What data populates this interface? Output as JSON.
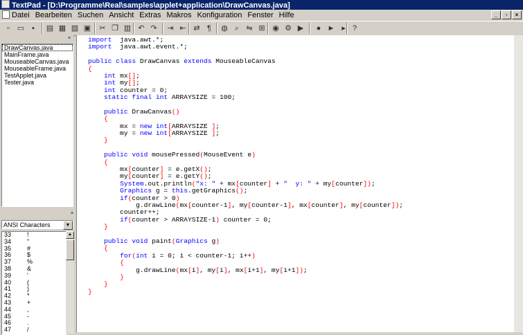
{
  "window": {
    "title": "TextPad - [D:\\Programme\\Real\\samples\\applet+application\\DrawCanvas.java]"
  },
  "menu": [
    "Datei",
    "Bearbeiten",
    "Suchen",
    "Ansicht",
    "Extras",
    "Makros",
    "Konfiguration",
    "Fenster",
    "Hilfe"
  ],
  "toolbar_icons": [
    "new-file-icon",
    "open-folder-icon",
    "save-icon",
    "save-all-icon",
    "print-icon",
    "print-preview-icon",
    "spellcheck-icon",
    "cut-icon",
    "copy-icon",
    "paste-icon",
    "undo-icon",
    "redo-icon",
    "indent-icon",
    "outdent-icon",
    "word-wrap-icon",
    "paragraph-icon",
    "web-icon",
    "find-icon",
    "find-replace-icon",
    "find-in-files-icon",
    "view-icon",
    "compile-icon",
    "run-icon",
    "record-macro-icon",
    "play-macro-icon",
    "step-macro-icon",
    "help-icon"
  ],
  "files": {
    "items": [
      "DrawCanvas.java",
      "MainFrame.java",
      "MouseableCanvas.java",
      "MouseableFrame.java",
      "TestApplet.java",
      "Tester.java"
    ],
    "selected": 0
  },
  "chars": {
    "charset": "ANSI Characters",
    "rows": [
      [
        "33",
        "!"
      ],
      [
        "34",
        "\""
      ],
      [
        "35",
        "#"
      ],
      [
        "36",
        "$"
      ],
      [
        "37",
        "%"
      ],
      [
        "38",
        "&"
      ],
      [
        "39",
        "'"
      ],
      [
        "40",
        "("
      ],
      [
        "41",
        ")"
      ],
      [
        "42",
        "*"
      ],
      [
        "43",
        "+"
      ],
      [
        "44",
        ","
      ],
      [
        "45",
        "-"
      ],
      [
        "46",
        "."
      ],
      [
        "47",
        "/"
      ]
    ]
  },
  "code": [
    [
      [
        "kw",
        "import"
      ],
      [
        "",
        "  java.awt.*;"
      ]
    ],
    [
      [
        "kw",
        "import"
      ],
      [
        "",
        "  java.awt.event.*;"
      ]
    ],
    [
      [
        "",
        ""
      ]
    ],
    [
      [
        "kw",
        "public class"
      ],
      [
        "",
        " DrawCanvas "
      ],
      [
        "kw",
        "extends"
      ],
      [
        "",
        " MouseableCanvas"
      ]
    ],
    [
      [
        "br",
        "{"
      ]
    ],
    [
      [
        "",
        "    "
      ],
      [
        "kw",
        "int"
      ],
      [
        "",
        " mx"
      ],
      [
        "br",
        "[]"
      ],
      [
        "",
        ";"
      ]
    ],
    [
      [
        "",
        "    "
      ],
      [
        "kw",
        "int"
      ],
      [
        "",
        " my"
      ],
      [
        "br",
        "[]"
      ],
      [
        "",
        ";"
      ]
    ],
    [
      [
        "",
        "    "
      ],
      [
        "kw",
        "int"
      ],
      [
        "",
        " counter = 0;"
      ]
    ],
    [
      [
        "",
        "    "
      ],
      [
        "kw",
        "static final int"
      ],
      [
        "",
        " ARRAYSIZE = 100;"
      ]
    ],
    [
      [
        "",
        ""
      ]
    ],
    [
      [
        "",
        "    "
      ],
      [
        "kw",
        "public"
      ],
      [
        "",
        " DrawCanvas"
      ],
      [
        "br",
        "()"
      ]
    ],
    [
      [
        "",
        "    "
      ],
      [
        "br",
        "{"
      ]
    ],
    [
      [
        "",
        "        mx = "
      ],
      [
        "kw",
        "new int"
      ],
      [
        "br",
        "["
      ],
      [
        "",
        "ARRAYSIZE "
      ],
      [
        "br",
        "]"
      ],
      [
        "",
        ";"
      ]
    ],
    [
      [
        "",
        "        my = "
      ],
      [
        "kw",
        "new int"
      ],
      [
        "br",
        "["
      ],
      [
        "",
        "ARRAYSIZE "
      ],
      [
        "br",
        "]"
      ],
      [
        "",
        ";"
      ]
    ],
    [
      [
        "",
        "    "
      ],
      [
        "br",
        "}"
      ]
    ],
    [
      [
        "",
        ""
      ]
    ],
    [
      [
        "",
        "    "
      ],
      [
        "kw",
        "public void"
      ],
      [
        "",
        " mousePressed"
      ],
      [
        "br",
        "("
      ],
      [
        "",
        "MouseEvent e"
      ],
      [
        "br",
        ")"
      ]
    ],
    [
      [
        "",
        "    "
      ],
      [
        "br",
        "{"
      ]
    ],
    [
      [
        "",
        "        mx"
      ],
      [
        "br",
        "["
      ],
      [
        "",
        "counter"
      ],
      [
        "br",
        "]"
      ],
      [
        "",
        " = e.getX"
      ],
      [
        "br",
        "()"
      ],
      [
        "",
        ";"
      ]
    ],
    [
      [
        "",
        "        my"
      ],
      [
        "br",
        "["
      ],
      [
        "",
        "counter"
      ],
      [
        "br",
        "]"
      ],
      [
        "",
        " = e.getY"
      ],
      [
        "br",
        "()"
      ],
      [
        "",
        ";"
      ]
    ],
    [
      [
        "",
        "        "
      ],
      [
        "fn",
        "System"
      ],
      [
        "",
        ".out.println"
      ],
      [
        "br",
        "("
      ],
      [
        "st",
        "\"x: \""
      ],
      [
        "",
        " + mx"
      ],
      [
        "br",
        "["
      ],
      [
        "",
        "counter"
      ],
      [
        "br",
        "]"
      ],
      [
        "",
        " + "
      ],
      [
        "st",
        "\"  y: \""
      ],
      [
        "",
        " + my"
      ],
      [
        "br",
        "["
      ],
      [
        "",
        "counter"
      ],
      [
        "br",
        "])"
      ],
      [
        "",
        ";"
      ]
    ],
    [
      [
        "",
        "        "
      ],
      [
        "fn",
        "Graphics"
      ],
      [
        "",
        " g = "
      ],
      [
        "kw",
        "this"
      ],
      [
        "",
        ".getGraphics"
      ],
      [
        "br",
        "()"
      ],
      [
        "",
        ";"
      ]
    ],
    [
      [
        "",
        "        "
      ],
      [
        "kw",
        "if"
      ],
      [
        "br",
        "("
      ],
      [
        "",
        "counter > 0"
      ],
      [
        "br",
        ")"
      ]
    ],
    [
      [
        "",
        "            g.drawLine"
      ],
      [
        "br",
        "("
      ],
      [
        "",
        "mx"
      ],
      [
        "br",
        "["
      ],
      [
        "",
        "counter-1"
      ],
      [
        "br",
        "]"
      ],
      [
        "",
        ", my"
      ],
      [
        "br",
        "["
      ],
      [
        "",
        "counter-1"
      ],
      [
        "br",
        "]"
      ],
      [
        "",
        ", mx"
      ],
      [
        "br",
        "["
      ],
      [
        "",
        "counter"
      ],
      [
        "br",
        "]"
      ],
      [
        "",
        ", my"
      ],
      [
        "br",
        "["
      ],
      [
        "",
        "counter"
      ],
      [
        "br",
        "])"
      ],
      [
        "",
        ";"
      ]
    ],
    [
      [
        "",
        "        counter++;"
      ]
    ],
    [
      [
        "",
        "        "
      ],
      [
        "kw",
        "if"
      ],
      [
        "br",
        "("
      ],
      [
        "",
        "counter > ARRAYSIZE-1"
      ],
      [
        "br",
        ")"
      ],
      [
        "",
        " counter = 0;"
      ]
    ],
    [
      [
        "",
        "    "
      ],
      [
        "br",
        "}"
      ]
    ],
    [
      [
        "",
        ""
      ]
    ],
    [
      [
        "",
        "    "
      ],
      [
        "kw",
        "public void"
      ],
      [
        "",
        " paint"
      ],
      [
        "br",
        "("
      ],
      [
        "fn",
        "Graphics"
      ],
      [
        "",
        " g"
      ],
      [
        "br",
        ")"
      ]
    ],
    [
      [
        "",
        "    "
      ],
      [
        "br",
        "{"
      ]
    ],
    [
      [
        "",
        "        "
      ],
      [
        "kw",
        "for"
      ],
      [
        "br",
        "("
      ],
      [
        "kw",
        "int"
      ],
      [
        "",
        " i = 0; i < counter-1; i++"
      ],
      [
        "br",
        ")"
      ]
    ],
    [
      [
        "",
        "        "
      ],
      [
        "br",
        "{"
      ]
    ],
    [
      [
        "",
        "            g.drawLine"
      ],
      [
        "br",
        "("
      ],
      [
        "",
        "mx"
      ],
      [
        "br",
        "["
      ],
      [
        "",
        "i"
      ],
      [
        "br",
        "]"
      ],
      [
        "",
        ", my"
      ],
      [
        "br",
        "["
      ],
      [
        "",
        "i"
      ],
      [
        "br",
        "]"
      ],
      [
        "",
        ", mx"
      ],
      [
        "br",
        "["
      ],
      [
        "",
        "i+1"
      ],
      [
        "br",
        "]"
      ],
      [
        "",
        ", my"
      ],
      [
        "br",
        "["
      ],
      [
        "",
        "i+1"
      ],
      [
        "br",
        "])"
      ],
      [
        "",
        ";"
      ]
    ],
    [
      [
        "",
        "        "
      ],
      [
        "br",
        "}"
      ]
    ],
    [
      [
        "",
        "    "
      ],
      [
        "br",
        "}"
      ]
    ],
    [
      [
        "br",
        "}"
      ]
    ]
  ]
}
